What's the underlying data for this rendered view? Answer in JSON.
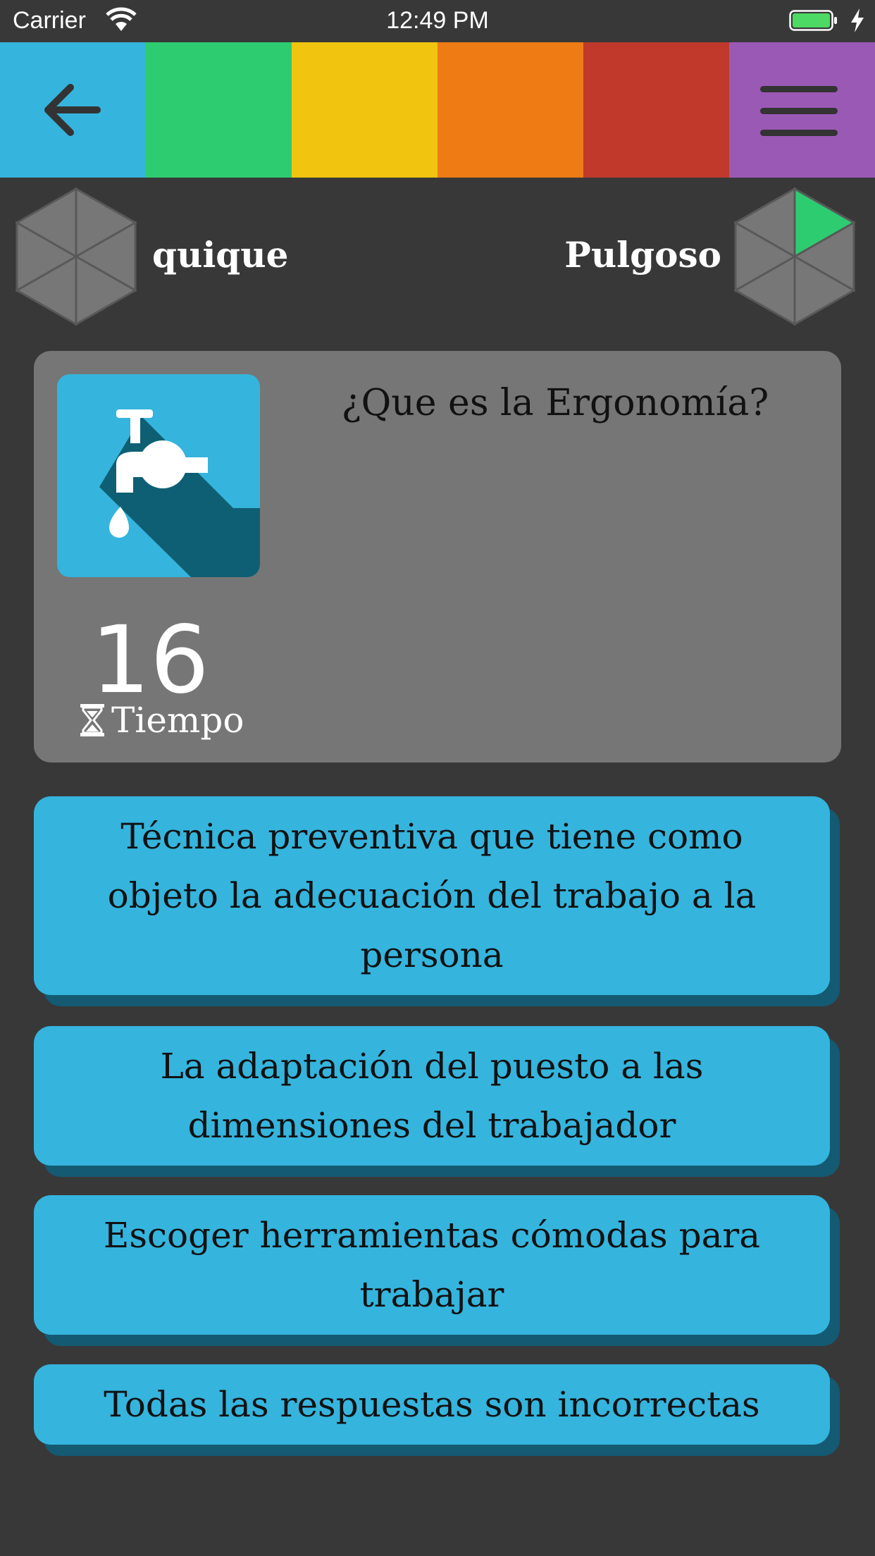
{
  "status_bar": {
    "carrier": "Carrier",
    "time": "12:49 PM",
    "battery_color": "#4cd964"
  },
  "color_bar": {
    "colors": [
      "#35b4dd",
      "#2ecc71",
      "#f1c40f",
      "#ee7b14",
      "#c0392b",
      "#9b59b6"
    ],
    "back_icon": "arrow-left-icon",
    "menu_icon": "hamburger-menu-icon"
  },
  "players": {
    "left": {
      "name": "quique",
      "wedges_filled": 0
    },
    "right": {
      "name": "Pulgoso",
      "wedges_filled": 1,
      "wedge_color": "#2ecc71"
    }
  },
  "question": {
    "category_icon": "water-tap-icon",
    "text": "¿Que es la Ergonomía?",
    "timer_value": "16",
    "timer_label": "Tiempo",
    "timer_icon": "hourglass-icon"
  },
  "answers": [
    {
      "text": "Técnica preventiva que tiene como objeto la adecuación del trabajo a la persona"
    },
    {
      "text": "La adaptación del puesto a las dimensiones del trabajador"
    },
    {
      "text": "Escoger herramientas cómodas para trabajar"
    },
    {
      "text": "Todas las respuestas son incorrectas"
    }
  ]
}
